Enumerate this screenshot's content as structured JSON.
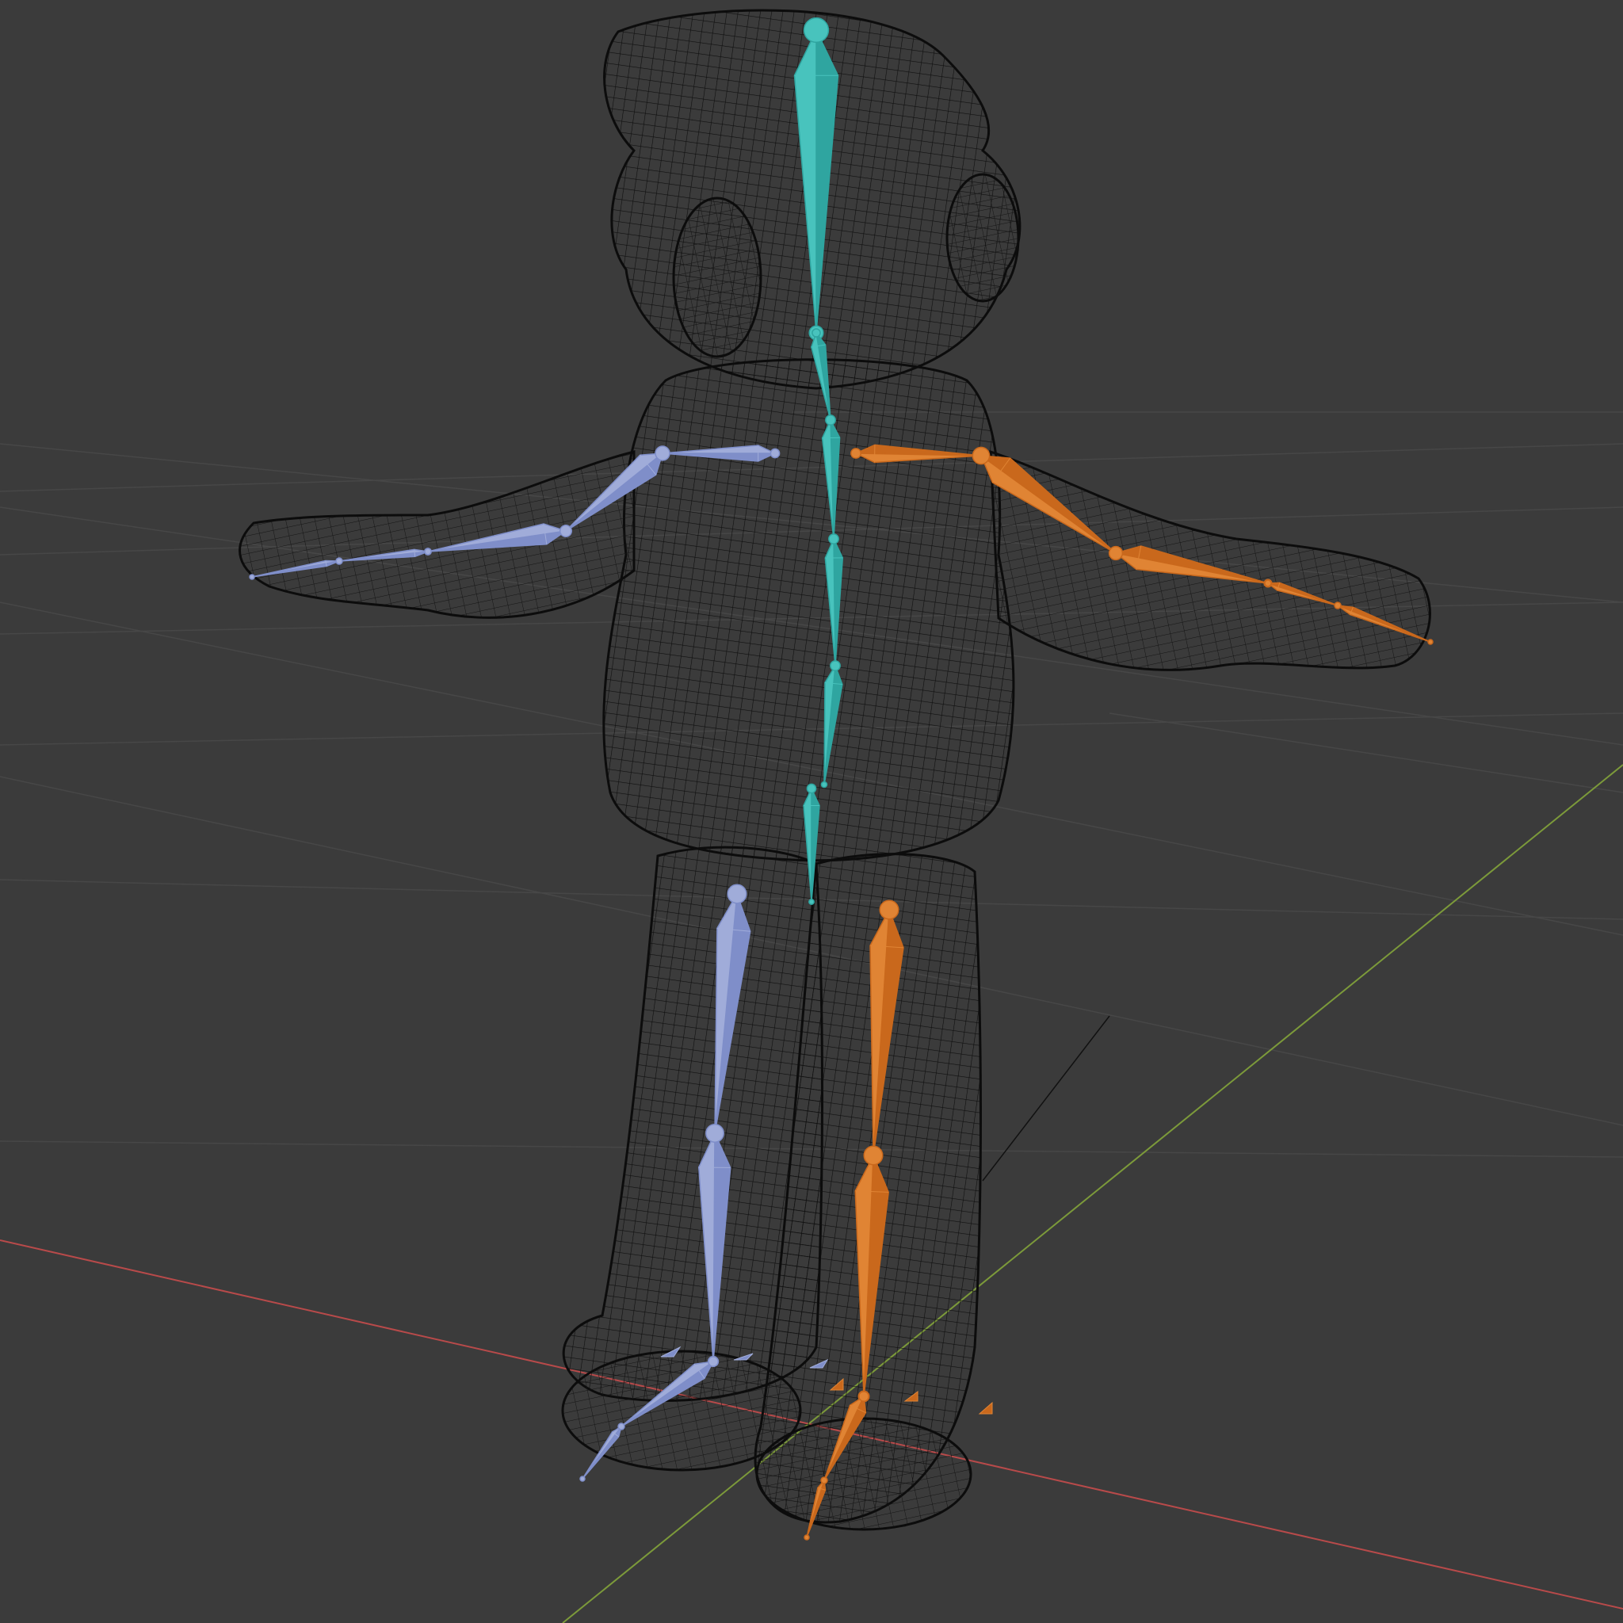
{
  "viewport": {
    "background": "#3b3b3b",
    "grid_color": "#4a4a4a",
    "x_axis_color": "#b84a4a",
    "y_axis_color": "#7c9a3a",
    "mesh_wire_color": "#111111"
  },
  "armature": {
    "colors": {
      "center": "#2fa5a0",
      "center_light": "#48c3bd",
      "left": "#7f8ec9",
      "left_light": "#a0acd9",
      "right": "#c9681c",
      "right_light": "#e08434"
    }
  }
}
